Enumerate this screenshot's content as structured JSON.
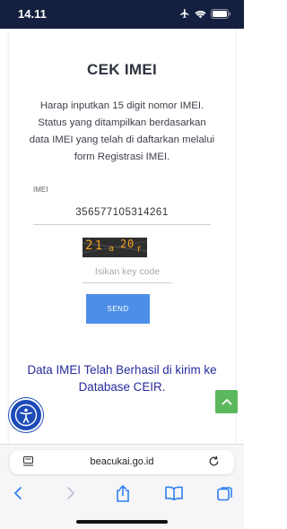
{
  "status_bar": {
    "time": "14.11",
    "icons": [
      "airplane-icon",
      "wifi-icon",
      "battery-icon"
    ]
  },
  "page": {
    "title": "CEK IMEI",
    "description": "Harap inputkan 15 digit nomor IMEI. Status yang ditampilkan berdasarkan data IMEI yang telah di daftarkan melalui form Registrasi IMEI.",
    "imei_label": "IMEI",
    "imei_value": "356577105314261",
    "captcha_text": "21a20f",
    "key_code_placeholder": "Isikan key code",
    "send_label": "SEND",
    "success_message": "Data IMEI Telah Berhasil di kirim ke Database CEIR."
  },
  "browser": {
    "url": "beacukai.go.id",
    "nav_icons": [
      "back-icon",
      "forward-icon",
      "share-icon",
      "bookmarks-icon",
      "tabs-icon"
    ]
  },
  "colors": {
    "status_bar_bg": "#152040",
    "send_button": "#4d8fe8",
    "success_text": "#262b9b",
    "scroll_top_button": "#5cb85c",
    "accessibility_button": "#1d4bb8",
    "browser_accent": "#2f7ff0"
  }
}
